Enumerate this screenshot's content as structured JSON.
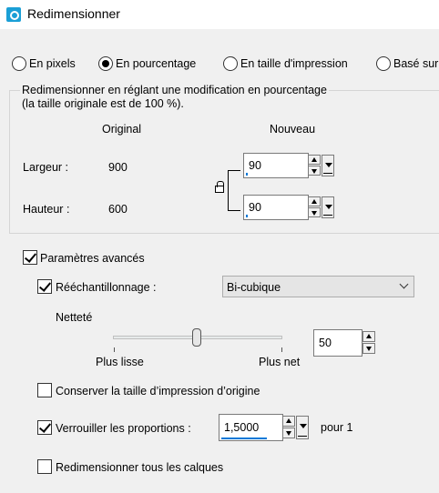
{
  "window": {
    "title": "Redimensionner"
  },
  "mode": {
    "options": [
      {
        "label": "En pixels",
        "checked": false
      },
      {
        "label": "En pourcentage",
        "checked": true
      },
      {
        "label": "En taille d'impression",
        "checked": false
      },
      {
        "label": "Basé sur",
        "checked": false
      }
    ]
  },
  "group": {
    "caption_line1": "Redimensionner en réglant une modification en pourcentage",
    "caption_line2": "(la taille originale est de 100 %).",
    "col_original": "Original",
    "col_new": "Nouveau",
    "width_label": "Largeur :",
    "width_original": "900",
    "width_new": "90",
    "height_label": "Hauteur :",
    "height_original": "600",
    "height_new": "90"
  },
  "advanced": {
    "label": "Paramètres avancés",
    "checked": true,
    "resample_label": "Rééchantillonnage :",
    "resample_checked": true,
    "resample_value": "Bi-cubique",
    "sharpness_label": "Netteté",
    "sharpness_value": "50",
    "slider_left_label": "Plus lisse",
    "slider_right_label": "Plus net",
    "keep_print_label": "Conserver la taille d’impression d’origine",
    "keep_print_checked": false,
    "lock_ratio_label": "Verrouiller les proportions :",
    "lock_ratio_checked": true,
    "ratio_value": "1,5000",
    "ratio_suffix": "pour 1",
    "all_layers_label": "Redimensionner tous les calques",
    "all_layers_checked": false
  },
  "colors": {
    "accent": "#0078d7",
    "icon": "#1a9fd6"
  },
  "icons": [
    "app-icon",
    "lock-icon",
    "chevron-down-icon"
  ]
}
